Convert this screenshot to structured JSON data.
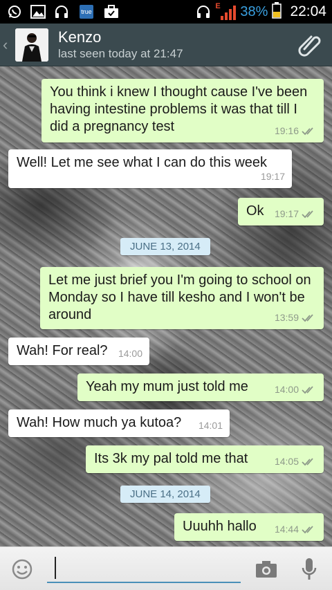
{
  "status_bar": {
    "left_icons": [
      "whatsapp-icon",
      "image-icon",
      "headphones-icon",
      "true-app-icon",
      "briefcase-icon"
    ],
    "true_label": "true",
    "network_label": "E",
    "battery_percent": "38%",
    "time": "22:04"
  },
  "header": {
    "contact_name": "Kenzo",
    "last_seen": "last seen today at 21:47"
  },
  "messages": [
    {
      "type": "out",
      "text": "You think i knew I thought cause I've been having intestine problems it was that till I did a pregnancy test",
      "time": "19:16",
      "ticks": "read"
    },
    {
      "type": "in",
      "text": "Well! Let me see what I can do this week",
      "time": "19:17"
    },
    {
      "type": "out",
      "text": "Ok",
      "time": "19:17",
      "ticks": "read"
    },
    {
      "type": "date",
      "text": "JUNE 13, 2014"
    },
    {
      "type": "out",
      "text": "Let me just brief you I'm going to school on Monday so I have till kesho and I won't be around",
      "time": "13:59",
      "ticks": "read"
    },
    {
      "type": "in",
      "text": "Wah! For real?",
      "time": "14:00"
    },
    {
      "type": "out",
      "text": "Yeah my mum just told me",
      "time": "14:00",
      "ticks": "read"
    },
    {
      "type": "in",
      "text": "Wah! How much ya kutoa?",
      "time": "14:01"
    },
    {
      "type": "out",
      "text": "Its 3k my pal told me that",
      "time": "14:05",
      "ticks": "read"
    },
    {
      "type": "date",
      "text": "JUNE 14, 2014"
    },
    {
      "type": "out",
      "text": "Uuuhh hallo",
      "time": "14:44",
      "ticks": "read"
    }
  ],
  "input": {
    "value": "",
    "placeholder": ""
  },
  "colors": {
    "header_bg": "#3b4a4f",
    "outgoing_bubble": "#e1fec6",
    "incoming_bubble": "#ffffff",
    "date_chip": "#d6ecf7",
    "read_ticks": "#34b7f1",
    "battery_accent": "#3aa0e0"
  }
}
